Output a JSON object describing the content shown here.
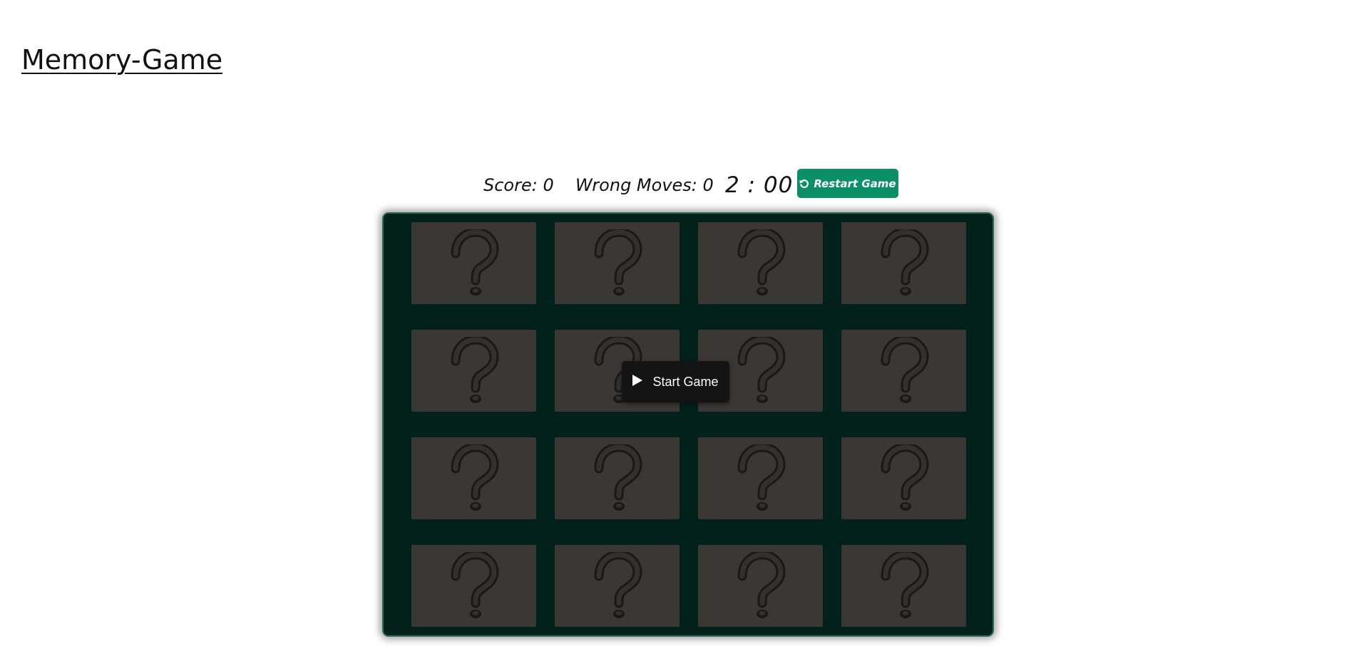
{
  "header": {
    "title": "Memory-Game"
  },
  "stats": {
    "score_label": "Score: 0",
    "wrong_moves_label": "Wrong Moves: 0",
    "timer": "2 : 00",
    "restart_label": "Restart Game",
    "restart_icon": "rotate-ccw-icon"
  },
  "board": {
    "rows": 4,
    "columns": 4,
    "card_face": "question-mark-icon",
    "colors": {
      "board_bg": "#02211a",
      "card_bg": "#3b3735",
      "accent": "#0a8f67"
    }
  },
  "overlay": {
    "start_label": "Start Game",
    "start_icon": "play-icon"
  }
}
